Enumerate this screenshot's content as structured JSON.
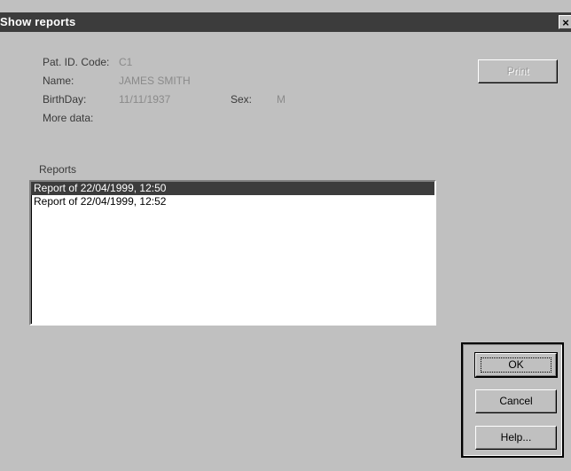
{
  "window": {
    "title": "Show reports",
    "close_glyph": "×"
  },
  "patient": {
    "id_label": "Pat. ID. Code:",
    "id_value": "C1",
    "name_label": "Name:",
    "name_value": "JAMES SMITH",
    "birthday_label": "BirthDay:",
    "birthday_value": "11/11/1937",
    "sex_label": "Sex:",
    "sex_value": "M",
    "more_label": "More data:"
  },
  "reports": {
    "label": "Reports",
    "items": [
      "Report of 22/04/1999, 12:50",
      "Report of 22/04/1999, 12:52"
    ],
    "selected_index": 0
  },
  "buttons": {
    "print": "Print",
    "ok": "OK",
    "cancel": "Cancel",
    "help": "Help..."
  }
}
